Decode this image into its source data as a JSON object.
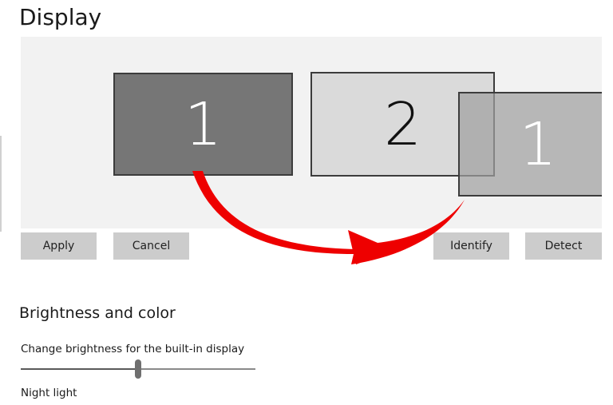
{
  "page": {
    "title": "Display"
  },
  "arrangement": {
    "monitors": [
      {
        "label": "1",
        "color": "#767676"
      },
      {
        "label": "2",
        "color": "#dadada"
      },
      {
        "label": "1",
        "color": "#a0a0a0"
      }
    ],
    "arrow_icon": "curved-arrow-icon",
    "arrow_color": "#ee0000"
  },
  "buttons": {
    "apply": "Apply",
    "cancel": "Cancel",
    "identify": "Identify",
    "detect": "Detect"
  },
  "brightness": {
    "heading": "Brightness and color",
    "label": "Change brightness for the built-in display",
    "value_fraction": 0.5
  },
  "night_light": {
    "label": "Night light"
  }
}
